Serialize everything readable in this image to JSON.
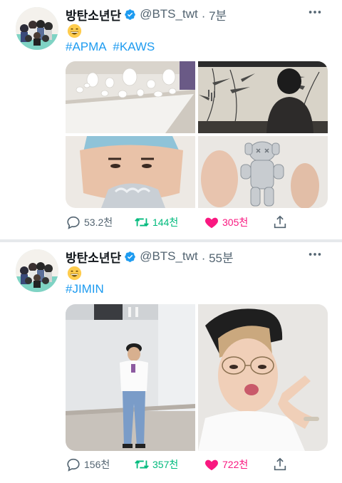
{
  "tweets": [
    {
      "author": {
        "name": "방탄소년단",
        "handle": "@BTS_twt",
        "time": "· 7분"
      },
      "emoji": "grinning-face-emoji",
      "hashtags": [
        "#APMA",
        "#KAWS"
      ],
      "photos": [
        "white porcelain jars exhibition",
        "person viewing bamboo painting",
        "selfie with blue hair holding silver figure",
        "silver KAWS figure"
      ],
      "stats": {
        "replies": "53.2천",
        "retweets": "144천",
        "likes": "305천"
      },
      "liked": true,
      "retweeted": true
    },
    {
      "author": {
        "name": "방탄소년단",
        "handle": "@BTS_twt",
        "time": "· 55분"
      },
      "emoji": "grinning-face-emoji",
      "hashtags": [
        "#JIMIN"
      ],
      "photos": [
        "mirror selfie in practice room",
        "selfie with glasses and beret"
      ],
      "stats": {
        "replies": "156천",
        "retweets": "357천",
        "likes": "722천"
      },
      "liked": true,
      "retweeted": true
    }
  ],
  "colors": {
    "accent": "#1d9bf0",
    "retweet": "#00ba7c",
    "like": "#f91880",
    "muted": "#536471"
  },
  "icons": [
    "verified-badge-icon",
    "more-icon",
    "reply-icon",
    "retweet-icon",
    "heart-icon",
    "share-icon"
  ]
}
